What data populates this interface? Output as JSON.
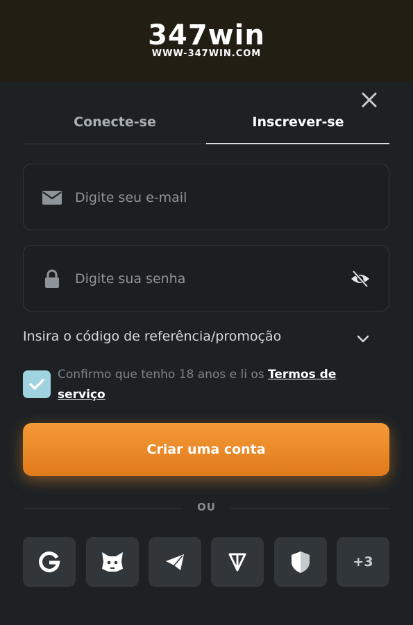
{
  "header": {
    "logo_text": "347win",
    "logo_url": "WWW-347WIN.COM"
  },
  "tabs": [
    {
      "label": "Conecte-se",
      "active": false
    },
    {
      "label": "Inscrever-se",
      "active": true
    }
  ],
  "email_field": {
    "placeholder": "Digite seu e-mail",
    "value": ""
  },
  "password_field": {
    "placeholder": "Digite sua senha",
    "value": ""
  },
  "promo": {
    "label": "Insira o código de referência/promoção"
  },
  "terms": {
    "checked": true,
    "text": "Confirmo que tenho 18 anos e li os ",
    "link": "Termos de serviço"
  },
  "cta": {
    "label": "Criar uma conta"
  },
  "divider": {
    "text": "OU"
  },
  "social": [
    {
      "icon": "google-icon"
    },
    {
      "icon": "metamask-icon"
    },
    {
      "icon": "telegram-icon"
    },
    {
      "icon": "ton-icon"
    },
    {
      "icon": "shield-icon"
    },
    {
      "label": "+3"
    }
  ],
  "colors": {
    "accent": "#f08a28",
    "checkbox": "#9fd3e0",
    "header_bg": "#231e14",
    "panel_bg": "#1d2124"
  }
}
